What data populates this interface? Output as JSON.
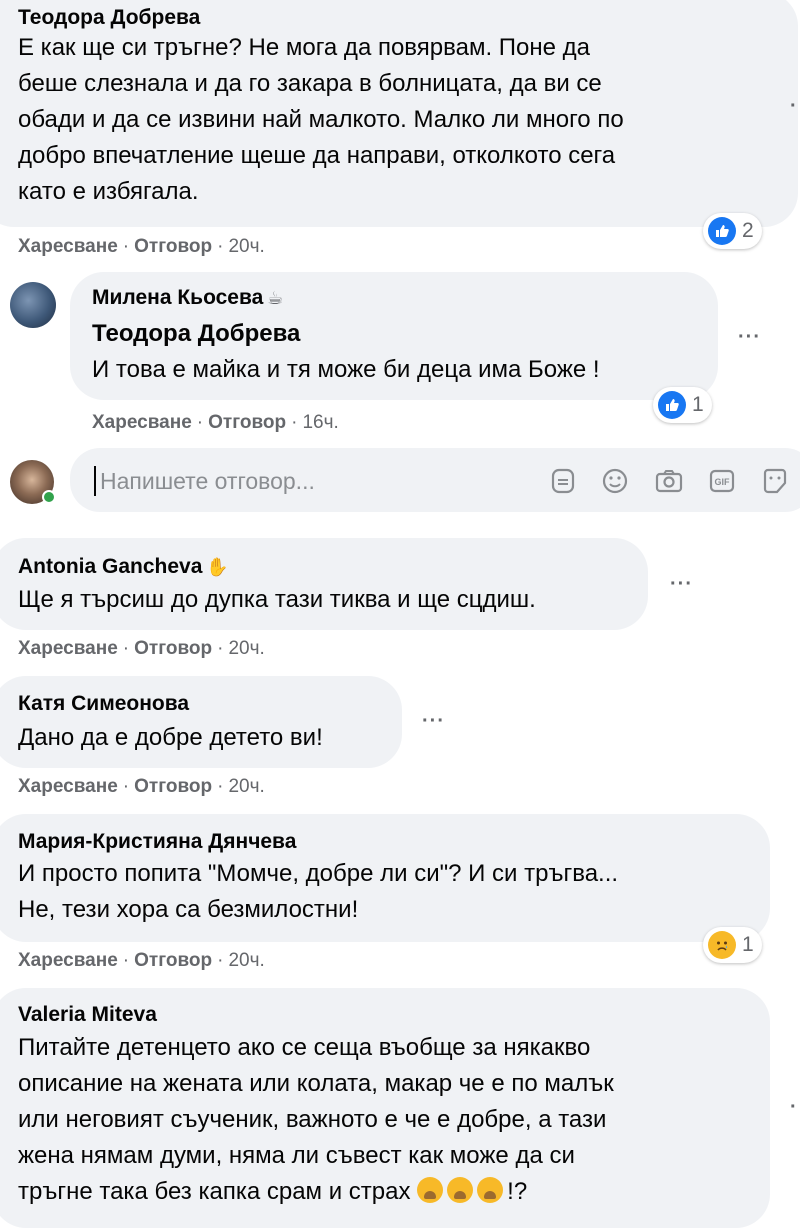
{
  "comments": [
    {
      "author": "Теодора Добрева",
      "lines": [
        "Е как ще си тръгне? Не мога да повярвам. Поне да",
        "беше слезнала и да го закара в болницата, да ви се",
        "обади и да се извини най малкото. Малко ли много по",
        "добро впечатление щеше да направи, отколкото сега",
        "като е избягала."
      ],
      "actions": {
        "like": "Харесване",
        "reply": "Отговор",
        "time": "20ч."
      },
      "reaction": {
        "type": "like",
        "count": "2"
      }
    },
    {
      "author": "Милена Кьосева",
      "mention": "Теодора Добрева",
      "lines": [
        "И това е майка и тя може би деца има Боже !"
      ],
      "actions": {
        "like": "Харесване",
        "reply": "Отговор",
        "time": "16ч."
      },
      "reaction": {
        "type": "like",
        "count": "1"
      }
    },
    {
      "author": "Antonia Gancheva",
      "lines": [
        "Ще я търсиш до дупка тази тиква и ще сцдиш."
      ],
      "actions": {
        "like": "Харесване",
        "reply": "Отговор",
        "time": "20ч."
      }
    },
    {
      "author": "Катя Симеонова",
      "lines": [
        "Дано да е добре детето ви!"
      ],
      "actions": {
        "like": "Харесване",
        "reply": "Отговор",
        "time": "20ч."
      }
    },
    {
      "author": "Мария-Кристияна Дянчева",
      "lines": [
        "И просто попита \"Момче, добре ли си\"? И си тръгва...",
        "Не, тези хора са безмилостни!"
      ],
      "actions": {
        "like": "Харесване",
        "reply": "Отговор",
        "time": "20ч."
      },
      "reaction": {
        "type": "sad",
        "count": "1"
      }
    },
    {
      "author": "Valeria Miteva",
      "lines": [
        "Питайте детенцето ако се сеща въобще за някакво",
        "описание на жената или колата, макар че е по малък",
        "или неговият съученик, важното е че е добре, а тази",
        "жена нямам думи, няма ли съвест как може да си",
        "тръгне така без капка срам и страх"
      ],
      "tail": "!?"
    }
  ],
  "reply": {
    "placeholder": "Напишете отговор..."
  },
  "colors": {
    "bubble": "#f0f2f5",
    "meta": "#65676b",
    "like": "#1877f2",
    "sad": "#f7b928"
  }
}
